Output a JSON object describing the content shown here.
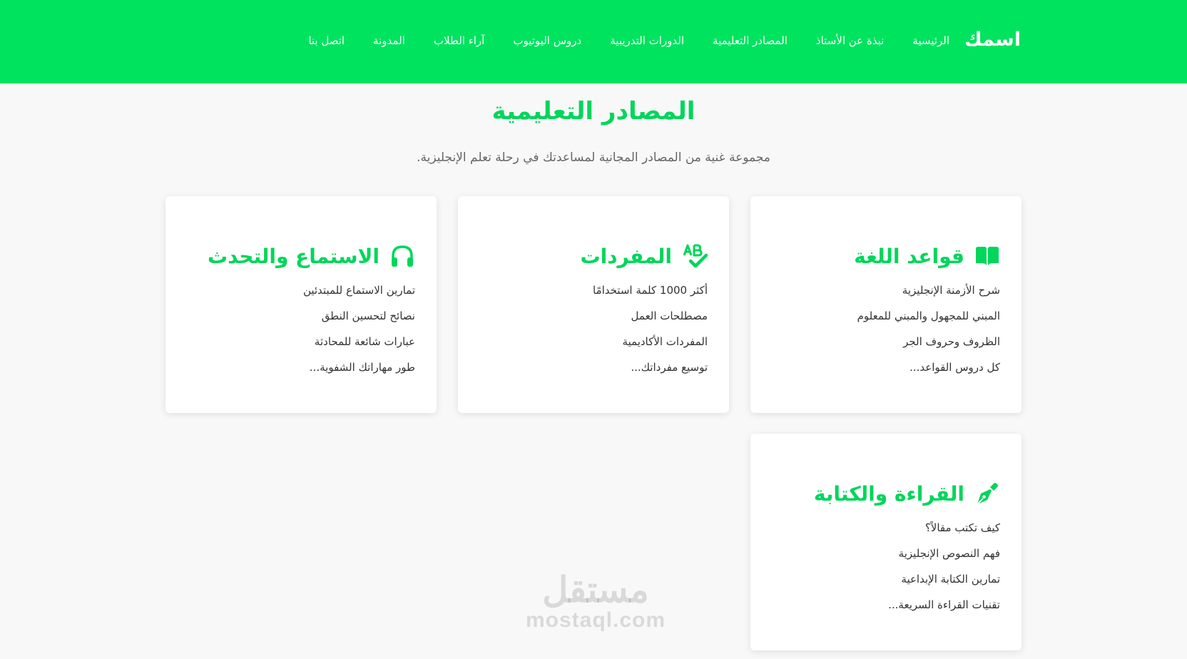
{
  "navbar": {
    "brand": "اسمك",
    "links": [
      "الرئيسية",
      "نبذة عن الأستاذ",
      "المصادر التعليمية",
      "الدورات التدريبية",
      "دروس اليوتيوب",
      "آراء الطلاب",
      "المدونة",
      "اتصل بنا"
    ]
  },
  "section": {
    "title": "المصادر التعليمية",
    "subtitle": "مجموعة غنية من المصادر المجانية لمساعدتك في رحلة تعلم الإنجليزية."
  },
  "cards": [
    {
      "icon": "book-icon",
      "title": "قواعد اللغة",
      "items": [
        "شرح الأزمنة الإنجليزية",
        "المبني للمجهول والمبني للمعلوم",
        "الظروف وحروف الجر",
        "كل دروس القواعد..."
      ]
    },
    {
      "icon": "spell-check-icon",
      "title": "المفردات",
      "items": [
        "أكثر 1000 كلمة استخدامًا",
        "مصطلحات العمل",
        "المفردات الأكاديمية",
        "توسيع مفرداتك..."
      ]
    },
    {
      "icon": "headphones-icon",
      "title": "الاستماع والتحدث",
      "items": [
        "تمارين الاستماع للمبتدئين",
        "نصائح لتحسين النطق",
        "عبارات شائعة للمحادثة",
        "طور مهاراتك الشفوية..."
      ]
    },
    {
      "icon": "pen-nib-icon",
      "title": "القراءة والكتابة",
      "items": [
        "كيف تكتب مقالاً؟",
        "فهم النصوص الإنجليزية",
        "تمارين الكتابة الإبداعية",
        "تقنيات القراءة السريعة..."
      ]
    }
  ],
  "watermark": {
    "arabic": "مستقل",
    "latin": "mostaql.com"
  },
  "colors": {
    "brand_green": "#00e35e",
    "heading_green": "#00d65a",
    "body_text": "#333333",
    "muted_text": "#666666",
    "page_background": "#f8f8f8"
  }
}
